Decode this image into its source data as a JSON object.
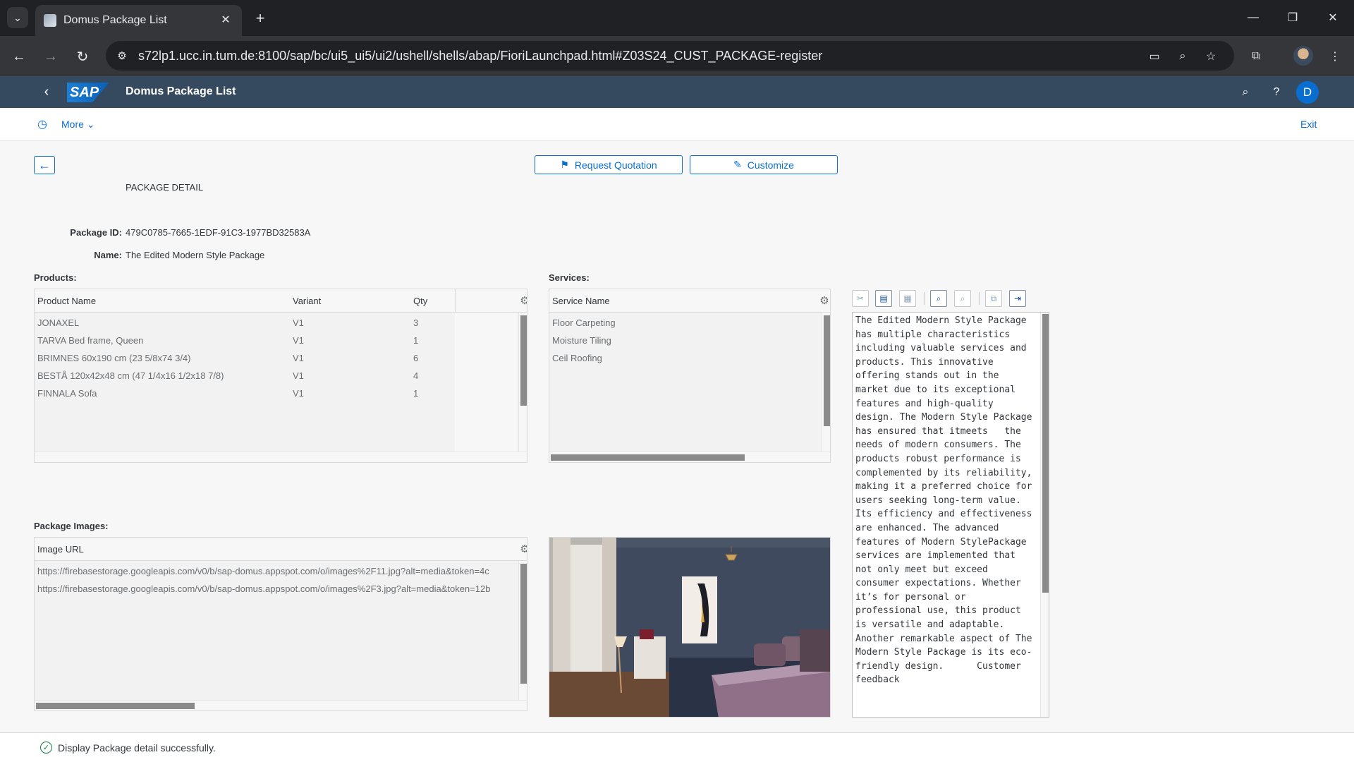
{
  "browser": {
    "tab_title": "Domus Package List",
    "url": "s72lp1.ucc.in.tum.de:8100/sap/bc/ui5_ui5/ui2/ushell/shells/abap/FioriLaunchpad.html#Z03S24_CUST_PACKAGE-register"
  },
  "shell": {
    "logo": "SAP",
    "title": "Domus Package List",
    "avatar_initial": "D"
  },
  "toolbar": {
    "more_label": "More",
    "exit_label": "Exit"
  },
  "actions": {
    "request_quotation": "Request Quotation",
    "customize": "Customize"
  },
  "page": {
    "heading": "PACKAGE DETAIL",
    "package_id_label": "Package ID:",
    "package_id": "479C0785-7665-1EDF-91C3-1977BD32583A",
    "name_label": "Name:",
    "name": "The Edited Modern Style Package"
  },
  "products": {
    "label": "Products:",
    "columns": [
      "Product Name",
      "Variant",
      "Qty"
    ],
    "rows": [
      [
        "JONAXEL",
        "V1",
        "3"
      ],
      [
        "TARVA Bed frame,  Queen",
        "V1",
        "1"
      ],
      [
        "BRIMNES 60x190 cm (23 5/8x74 3/4)",
        "V1",
        "6"
      ],
      [
        "BESTÅ 120x42x48 cm (47 1/4x16 1/2x18 7/8)",
        "V1",
        "4"
      ],
      [
        "FINNALA Sofa",
        "V1",
        "1"
      ]
    ]
  },
  "services": {
    "label": "Services:",
    "column": "Service Name",
    "rows": [
      "Floor Carpeting",
      "Moisture Tiling",
      "Ceil Roofing"
    ]
  },
  "images": {
    "label": "Package Images:",
    "column": "Image URL",
    "rows": [
      "https://firebasestorage.googleapis.com/v0/b/sap-domus.appspot.com/o/images%2F11.jpg?alt=media&token=4c",
      "https://firebasestorage.googleapis.com/v0/b/sap-domus.appspot.com/o/images%2F3.jpg?alt=media&token=12b"
    ]
  },
  "description": "The Edited Modern Style Package has multiple characteristics including valuable services and products. This innovative offering stands out in the market due to its exceptional features and high-quality design. The Modern Style Package has ensured that itmeets   the needs of modern consumers. The products robust performance is complemented by its reliability, making it a preferred choice for users seeking long-term value. Its efficiency and effectiveness are enhanced. The advanced features of Modern StylePackage services are implemented that not only meet but exceed consumer expectations. Whether it’s for personal or professional use, this product is versatile and adaptable. Another remarkable aspect of The Modern Style Package is its eco-friendly design.      Customer feedback",
  "status": {
    "message": "Display Package detail successfully."
  },
  "colors": {
    "shell": "#354a5f",
    "accent": "#0a6ed1",
    "success": "#107e3e"
  }
}
